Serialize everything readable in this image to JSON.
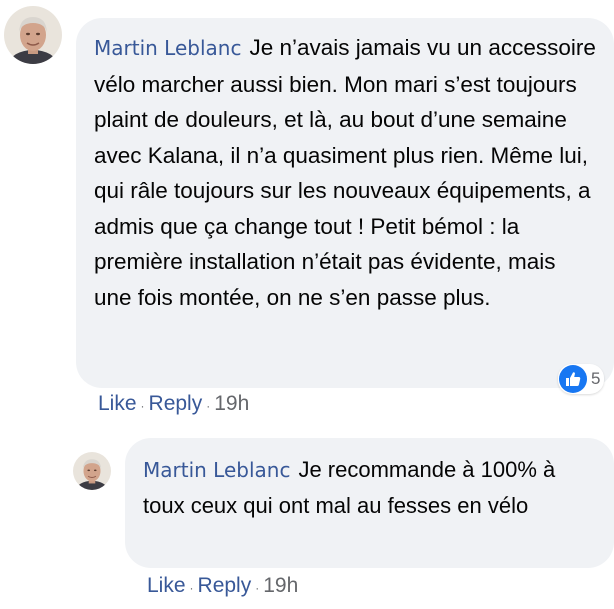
{
  "comment": {
    "author": "Martin Leblanc",
    "text": "Je n’avais jamais vu un accessoire vélo marcher aussi bien. Mon mari s’est toujours plaint de douleurs, et là, au bout d’une semaine avec Kalana, il n’a quasiment plus rien. Même lui, qui râle toujours sur les nouveaux équipements, a admis que ça change tout ! Petit bémol : la première installation n’était pas évidente, mais une fois montée, on ne s’en passe plus.",
    "reaction_icon": "thumbs-up-icon",
    "reaction_count": "5",
    "like_label": "Like",
    "reply_label": "Reply",
    "separator": "·",
    "timestamp": "19h"
  },
  "reply": {
    "author": "Martin Leblanc",
    "text": "Je recommande à 100% à toux ceux qui ont mal au fesses en vélo",
    "like_label": "Like",
    "reply_label": "Reply",
    "separator": "·",
    "timestamp": "19h"
  },
  "colors": {
    "bubble_bg": "#f0f2f5",
    "author": "#385898",
    "like_blue": "#1877f2",
    "meta_gray": "#65676b"
  }
}
